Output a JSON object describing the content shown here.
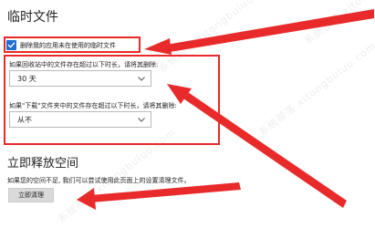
{
  "temp_files": {
    "title": "临时文件",
    "delete_unused_checkbox_label": "删除我的应用未在使用的临时文件",
    "delete_unused_checked": true
  },
  "recycle_bin": {
    "label": "如果回收站中的文件存在超过以下时长，请将其删除:",
    "selected": "30 天"
  },
  "downloads": {
    "label": "如果\"下载\"文件夹中的文件存在超过以下时长，请将其删除:",
    "selected": "从不"
  },
  "free_space": {
    "title": "立即释放空间",
    "description": "如果您的空间不足, 我们可以尝试使用此页面上的设置清理文件。",
    "button_label": "立即清理"
  },
  "annotation_color": "#e82a2a",
  "watermark": {
    "text": "系统部落 xitongbuluo.com"
  }
}
